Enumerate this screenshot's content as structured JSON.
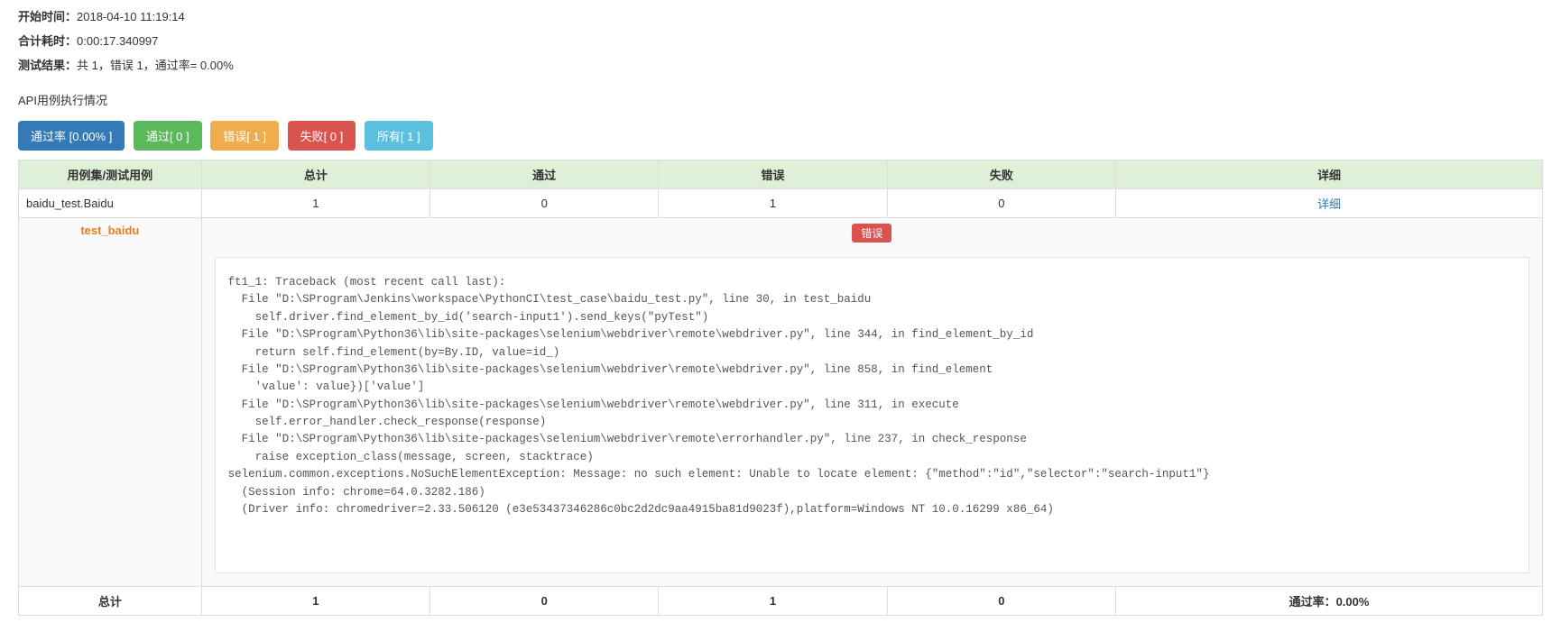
{
  "meta": {
    "start_label": "开始时间：",
    "start_value": "2018-04-10 11:19:14",
    "elapsed_label": "合计耗时：",
    "elapsed_value": "0:00:17.340997",
    "result_label": "测试结果：",
    "result_value": "共 1，错误 1，通过率= 0.00%"
  },
  "section_title": "API用例执行情况",
  "buttons": {
    "pass_rate": "通过率 [0.00% ]",
    "pass": "通过[ 0 ]",
    "error": "错误[ 1 ]",
    "fail": "失败[ 0 ]",
    "all": "所有[ 1 ]"
  },
  "headers": {
    "suite": "用例集/测试用例",
    "total": "总计",
    "pass": "通过",
    "error": "错误",
    "fail": "失败",
    "detail": "详细"
  },
  "suite": {
    "name": "baidu_test.Baidu",
    "total": "1",
    "pass": "0",
    "error": "1",
    "fail": "0",
    "detail_link": "详细"
  },
  "case": {
    "name": "test_baidu",
    "badge": "错误",
    "trace": "ft1_1: Traceback (most recent call last):\n  File \"D:\\SProgram\\Jenkins\\workspace\\PythonCI\\test_case\\baidu_test.py\", line 30, in test_baidu\n    self.driver.find_element_by_id('search-input1').send_keys(\"pyTest\")\n  File \"D:\\SProgram\\Python36\\lib\\site-packages\\selenium\\webdriver\\remote\\webdriver.py\", line 344, in find_element_by_id\n    return self.find_element(by=By.ID, value=id_)\n  File \"D:\\SProgram\\Python36\\lib\\site-packages\\selenium\\webdriver\\remote\\webdriver.py\", line 858, in find_element\n    'value': value})['value']\n  File \"D:\\SProgram\\Python36\\lib\\site-packages\\selenium\\webdriver\\remote\\webdriver.py\", line 311, in execute\n    self.error_handler.check_response(response)\n  File \"D:\\SProgram\\Python36\\lib\\site-packages\\selenium\\webdriver\\remote\\errorhandler.py\", line 237, in check_response\n    raise exception_class(message, screen, stacktrace)\nselenium.common.exceptions.NoSuchElementException: Message: no such element: Unable to locate element: {\"method\":\"id\",\"selector\":\"search-input1\"}\n  (Session info: chrome=64.0.3282.186)\n  (Driver info: chromedriver=2.33.506120 (e3e53437346286c0bc2d2dc9aa4915ba81d9023f),platform=Windows NT 10.0.16299 x86_64)\n"
  },
  "footer": {
    "label": "总计",
    "total": "1",
    "pass": "0",
    "error": "1",
    "fail": "0",
    "rate": "通过率：0.00%"
  }
}
